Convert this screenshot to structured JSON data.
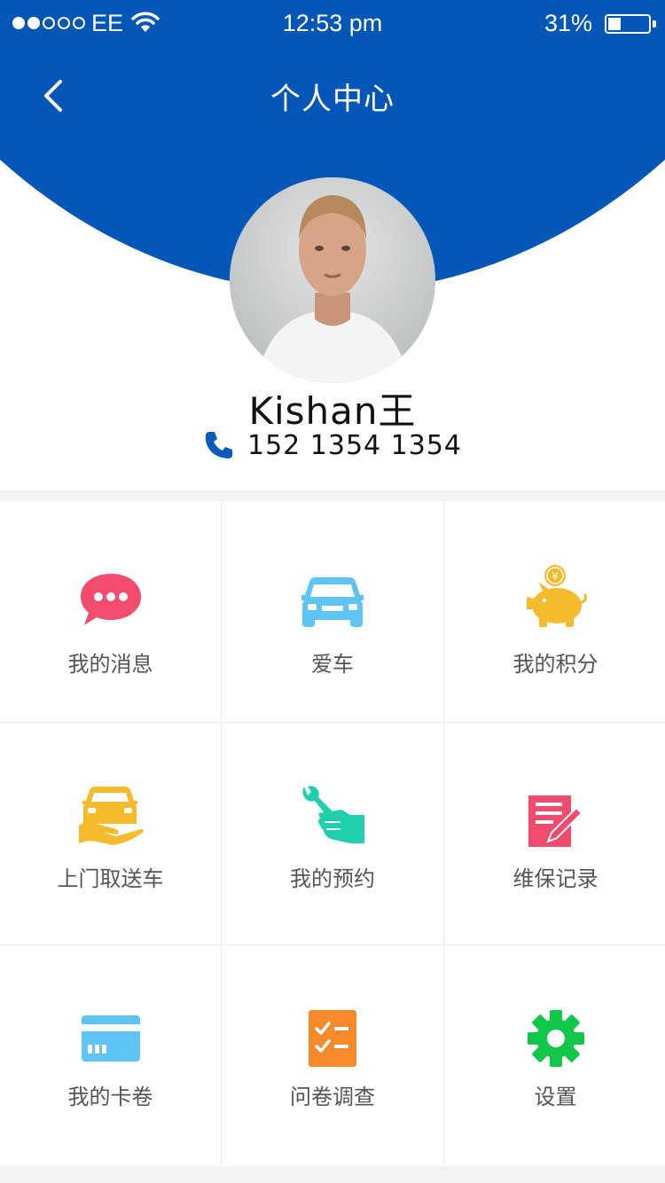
{
  "status_bar": {
    "carrier": "EE",
    "time": "12:53 pm",
    "battery_percent": "31%",
    "battery_level": 0.31
  },
  "nav": {
    "title": "个人中心",
    "back_icon": "chevron-left-icon"
  },
  "profile": {
    "name": "Kishan王",
    "phone": "152 1354 1354",
    "phone_icon": "phone-icon"
  },
  "menu": [
    {
      "label": "我的消息",
      "icon": "chat-bubble-icon",
      "color": "#f24b6e"
    },
    {
      "label": "爱车",
      "icon": "car-icon",
      "color": "#5ec3f5"
    },
    {
      "label": "我的积分",
      "icon": "piggy-bank-icon",
      "color": "#f5bb2d"
    },
    {
      "label": "上门取送车",
      "icon": "car-in-hand-icon",
      "color": "#f5bb2d"
    },
    {
      "label": "我的预约",
      "icon": "wrench-hand-icon",
      "color": "#1fcfae"
    },
    {
      "label": "维保记录",
      "icon": "document-pencil-icon",
      "color": "#f24b6e"
    },
    {
      "label": "我的卡卷",
      "icon": "card-icon",
      "color": "#5ec3f5"
    },
    {
      "label": "问卷调查",
      "icon": "checklist-icon",
      "color": "#f58a2b"
    },
    {
      "label": "设置",
      "icon": "gear-icon",
      "color": "#12c64a"
    }
  ]
}
